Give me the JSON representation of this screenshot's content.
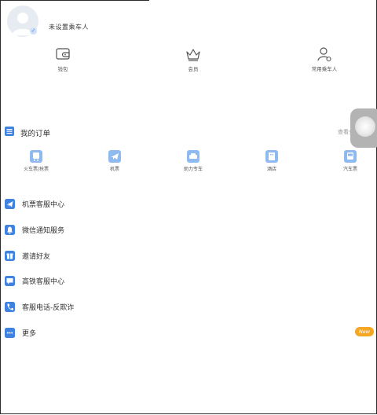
{
  "header": {
    "passenger_label": "未设置乘车人"
  },
  "quick_actions": [
    {
      "label": "钱包",
      "icon": "wallet-icon"
    },
    {
      "label": "会员",
      "icon": "crown-icon"
    },
    {
      "label": "常用乘车人",
      "icon": "passenger-icon"
    }
  ],
  "orders": {
    "title": "我的订单",
    "view_all": "查看全部订单",
    "types": [
      {
        "label": "火车票/抢票",
        "icon": "train-icon"
      },
      {
        "label": "机票",
        "icon": "plane-icon"
      },
      {
        "label": "助力专车",
        "icon": "car-icon"
      },
      {
        "label": "酒店",
        "icon": "hotel-icon"
      },
      {
        "label": "汽车票",
        "icon": "bus-icon"
      }
    ]
  },
  "menu": [
    {
      "label": "机票客服中心",
      "icon": "plane-icon"
    },
    {
      "label": "微信通知服务",
      "icon": "bell-icon"
    },
    {
      "label": "邀请好友",
      "icon": "gift-icon"
    },
    {
      "label": "高铁客服中心",
      "icon": "chat-icon"
    },
    {
      "label": "客服电话-反欺诈",
      "icon": "phone-icon"
    },
    {
      "label": "更多",
      "icon": "more-icon"
    }
  ],
  "badge": {
    "text": "New"
  },
  "colors": {
    "accent": "#3f82e0",
    "icon_light": "#8fbaf0",
    "badge": "#f5a623"
  }
}
